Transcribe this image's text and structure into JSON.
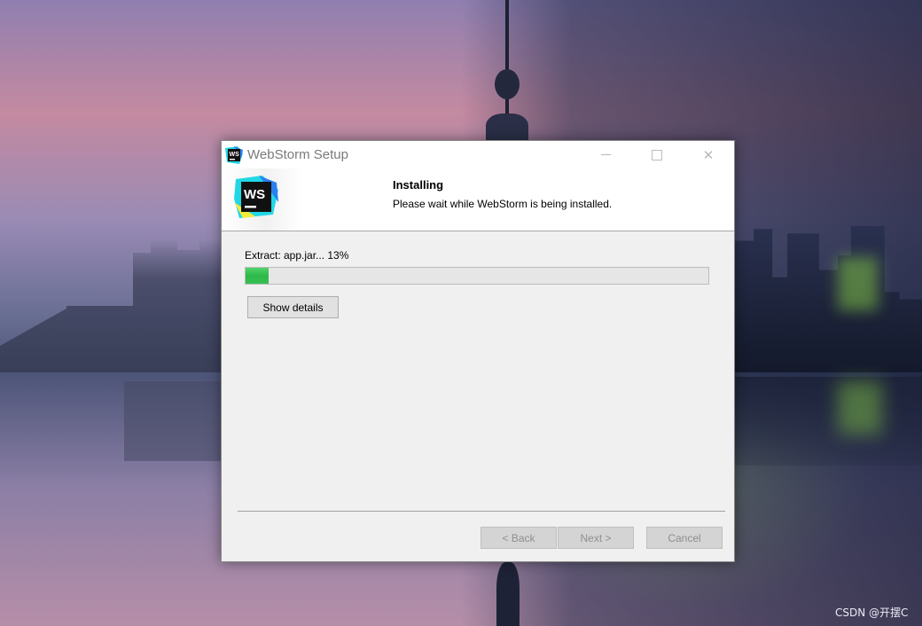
{
  "window": {
    "title": "WebStorm Setup",
    "controls": {
      "minimize_icon": "minimize-icon",
      "maximize_icon": "maximize-icon",
      "close_glyph": "✕"
    }
  },
  "header": {
    "logo_text": "WS",
    "title": "Installing",
    "subtitle": "Please wait while WebStorm is being installed."
  },
  "progress": {
    "status_text": "Extract: app.jar... 13%",
    "fraction": 0.05
  },
  "buttons": {
    "show_details": "Show details",
    "back": "< Back",
    "next": "Next >",
    "cancel": "Cancel"
  },
  "desktop": {
    "watermark": "CSDN @开摆C"
  },
  "colors": {
    "progress_fill": "#35c050",
    "logo_bg": "#1d1d1d",
    "logo_accent_cyan": "#21d7e6",
    "logo_accent_yellow": "#f5ea3a"
  }
}
